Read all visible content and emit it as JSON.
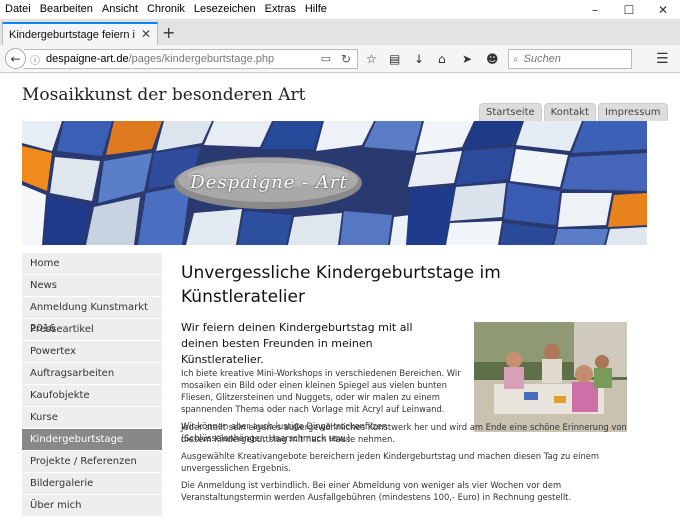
{
  "menubar": {
    "items": [
      "Datei",
      "Bearbeiten",
      "Ansicht",
      "Chronik",
      "Lesezeichen",
      "Extras",
      "Hilfe"
    ]
  },
  "window": {
    "minimize": "–",
    "maximize": "☐",
    "close": "✕"
  },
  "tab": {
    "title": "Kindergeburtstage feiern im K...",
    "close": "✕",
    "new_tab": "+"
  },
  "address": {
    "host": "despaigne-art.de",
    "path": "/pages/kindergeburtstage.php"
  },
  "search": {
    "placeholder": "Suchen"
  },
  "page": {
    "site_title": "Mosaikkunst der besonderen Art",
    "top_nav": [
      "Startseite",
      "Kontakt",
      "Impressum"
    ],
    "banner_brand": "Despaigne  -  Art",
    "sidebar": [
      {
        "label": "Home",
        "active": false
      },
      {
        "label": "News",
        "active": false
      },
      {
        "label": "Anmeldung Kunstmarkt 2016",
        "active": false
      },
      {
        "label": "Presseartikel",
        "active": false
      },
      {
        "label": "Powertex",
        "active": false
      },
      {
        "label": "Auftragsarbeiten",
        "active": false
      },
      {
        "label": "Kaufobjekte",
        "active": false
      },
      {
        "label": "Kurse",
        "active": false
      },
      {
        "label": "Kindergeburtstage",
        "active": true
      },
      {
        "label": "Projekte / Referenzen",
        "active": false
      },
      {
        "label": "Bildergalerie",
        "active": false
      },
      {
        "label": "Über mich",
        "active": false
      }
    ],
    "heading": "Unvergessliche Kindergeburtstage im Künstleratelier",
    "lead": "Wir feiern deinen Kindergeburtstag mit all deinen besten Freunden in meinen Künstleratelier.",
    "p1": "Ich biete kreative Mini-Workshops in verschiedenen Bereichen. Wir mosaiken ein Bild oder einen kleinen Spiegel aus vielen bunten Fliesen, Glitzersteinen und Nuggets, oder wir malen zu einem spannenden Thema oder nach Vorlage mit Acryl auf Leinwand.",
    "p2": "Wir können aber auch lustige Dinge trockenfilzen (Schlüsselanhänger, Haarschmuck usw.)",
    "p3": "Jeder stellt sein eigenes außergewöhnliches Kunstwerk her und wird am Ende eine schöne Erinnerung von diesem Kindergeburtstag mit nach Hause nehmen.",
    "p4": "Ausgewählte Kreativangebote bereichern jeden Kindergeburtstag und machen diesen Tag zu einem unvergesslichen Ergebnis.",
    "p5": "Die Anmeldung ist verbindlich. Bei einer Abmeldung von weniger als vier Wochen vor dem Veranstaltungstermin werden Ausfallgebühren (mindestens 100,- Euro) in Rechnung gestellt."
  }
}
